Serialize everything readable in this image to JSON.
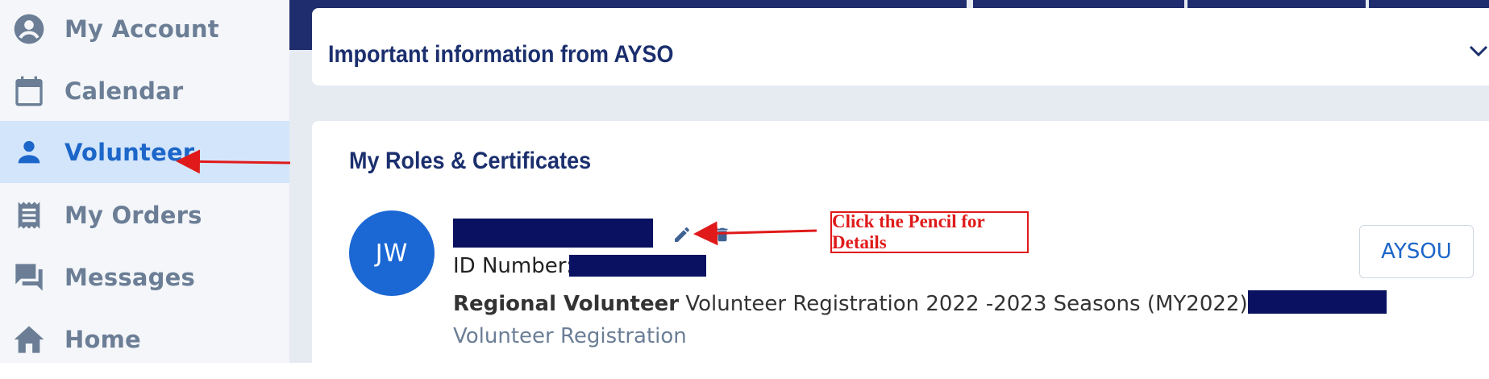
{
  "sidebar": {
    "items": [
      {
        "label": "My Account",
        "icon": "account-circle-icon"
      },
      {
        "label": "Calendar",
        "icon": "calendar-icon"
      },
      {
        "label": "Volunteer",
        "icon": "person-icon",
        "active": true
      },
      {
        "label": "My Orders",
        "icon": "receipt-icon"
      },
      {
        "label": "Messages",
        "icon": "chat-icon"
      },
      {
        "label": "Home",
        "icon": "home-icon"
      }
    ]
  },
  "info": {
    "title": "Important information from AYSO"
  },
  "roles": {
    "title": "My Roles & Certificates",
    "avatar_initials": "JW",
    "id_label": "ID Number:",
    "role_bold": "Regional Volunteer",
    "role_text": "Volunteer Registration 2022 -2023 Seasons (MY2022)",
    "role_link": "Volunteer Registration",
    "aysou_button": "AYSOU"
  },
  "annotation": {
    "callout_text": "Click the Pencil for Details"
  },
  "colors": {
    "topbar": "#1f2d6e",
    "accent": "#1c66c9",
    "active_bg": "#d3e5fb",
    "annotation_red": "#e01a1a",
    "redaction": "#0a1160"
  }
}
